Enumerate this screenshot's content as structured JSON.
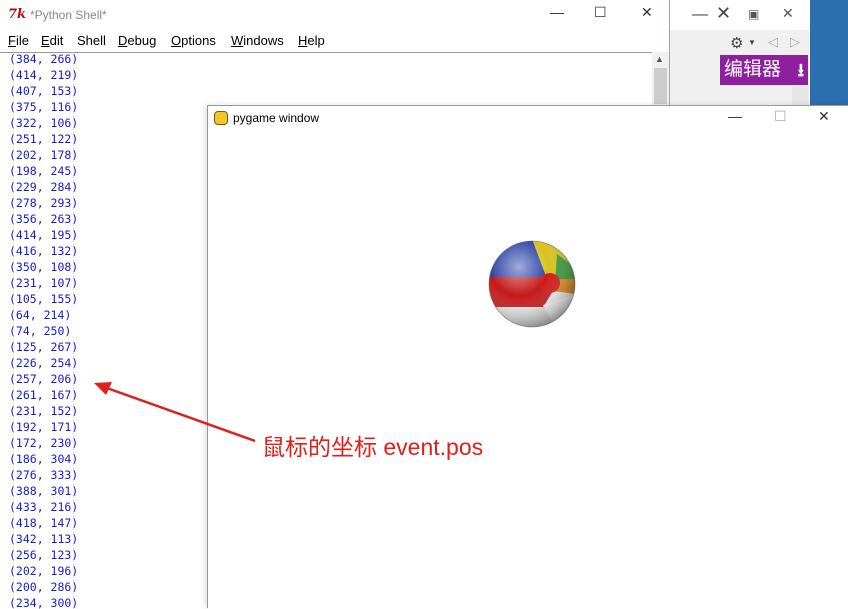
{
  "shell": {
    "title": "*Python Shell*",
    "logo": "7k",
    "controls": {
      "minimize": "—",
      "maximize": "☐",
      "close": "✕"
    },
    "menu": [
      {
        "ul": "F",
        "rest": "ile"
      },
      {
        "ul": "E",
        "rest": "dit"
      },
      {
        "ul": "",
        "rest": "Shell"
      },
      {
        "ul": "D",
        "rest": "ebug"
      },
      {
        "ul": "O",
        "rest": "ptions"
      },
      {
        "ul": "W",
        "rest": "indows"
      },
      {
        "ul": "H",
        "rest": "elp"
      }
    ],
    "output_lines": [
      "(384, 266)",
      "(414, 219)",
      "(407, 153)",
      "(375, 116)",
      "(322, 106)",
      "(251, 122)",
      "(202, 178)",
      "(198, 245)",
      "(229, 284)",
      "(278, 293)",
      "(356, 263)",
      "(414, 195)",
      "(416, 132)",
      "(350, 108)",
      "(231, 107)",
      "(105, 155)",
      "(64, 214)",
      "(74, 250)",
      "(125, 267)",
      "(226, 254)",
      "(257, 206)",
      "(261, 167)",
      "(231, 152)",
      "(192, 171)",
      "(172, 230)",
      "(186, 304)",
      "(276, 333)",
      "(388, 301)",
      "(433, 216)",
      "(418, 147)",
      "(342, 113)",
      "(256, 123)",
      "(202, 196)",
      "(200, 286)",
      "(234, 300)"
    ],
    "text_color": "#1a1ad0"
  },
  "background_window": {
    "minimize": "—",
    "close": "✕",
    "badge_text": "编辑器",
    "badge_icon": "download-icon",
    "badge_color": "#8e1f9f"
  },
  "pygame": {
    "title": "pygame window",
    "controls": {
      "minimize": "—",
      "maximize": "☐",
      "close": "✕"
    },
    "sprite": "beach-ball"
  },
  "annotation": {
    "text": "鼠标的坐标 event.pos",
    "color": "#e0201c"
  }
}
